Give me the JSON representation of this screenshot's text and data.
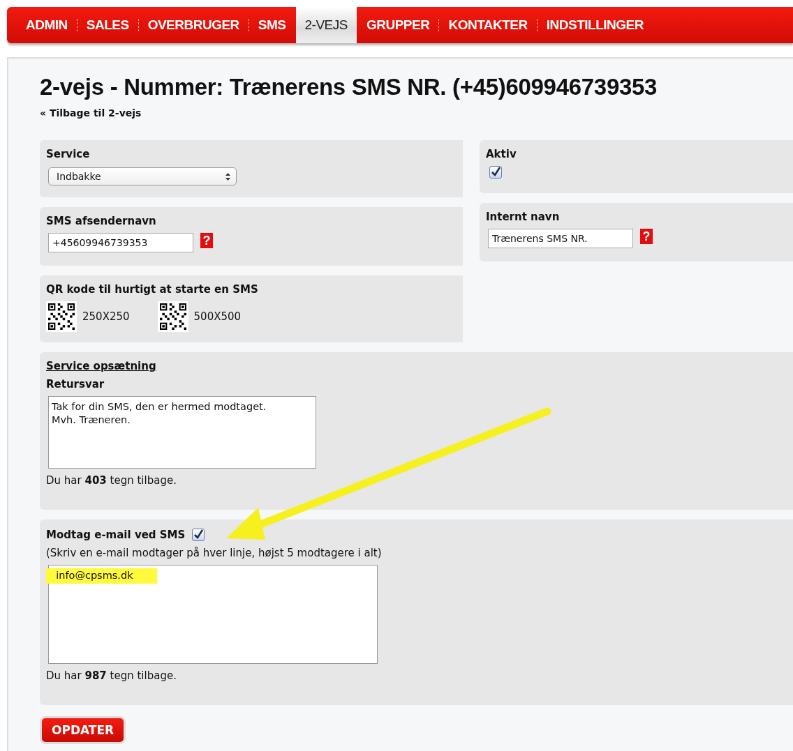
{
  "nav": {
    "tabs": [
      {
        "label": "ADMIN",
        "selected": false
      },
      {
        "label": "SALES",
        "selected": false
      },
      {
        "label": "OVERBRUGER",
        "selected": false
      },
      {
        "label": "SMS",
        "selected": false
      },
      {
        "label": "2-VEJS",
        "selected": true
      },
      {
        "label": "GRUPPER",
        "selected": false
      },
      {
        "label": "KONTAKTER",
        "selected": false
      },
      {
        "label": "INDSTILLINGER",
        "selected": false
      }
    ]
  },
  "title": "2-vejs - Nummer: Trænerens SMS NR. (+45)609946739353",
  "back_link": "« Tilbage til 2-vejs",
  "service": {
    "label": "Service",
    "value": "Indbakke"
  },
  "active": {
    "label": "Aktiv",
    "checked": true
  },
  "sender": {
    "label": "SMS afsendernavn",
    "value": "+45609946739353",
    "help": "?"
  },
  "internal_name": {
    "label": "Internt navn",
    "value": "Trænerens SMS NR.",
    "help": "?"
  },
  "qr": {
    "label": "QR kode til hurtigt at starte en SMS",
    "codes": [
      "250X250",
      "500X500"
    ]
  },
  "setup": {
    "heading": "Service opsætning",
    "reply_label": "Retursvar",
    "reply_value": "Tak for din SMS, den er hermed modtaget.\nMvh. Træneren.",
    "remaining": "Du har **403** tegn tilbage."
  },
  "email": {
    "label": "Modtag e-mail ved SMS",
    "checked": true,
    "hint": "(Skriv en e-mail modtager på hver linje, højst 5 modtagere i alt)",
    "value": "info@cpsms.dk",
    "remaining": "Du har **987** tegn tilbage."
  },
  "submit": "OPDATER"
}
